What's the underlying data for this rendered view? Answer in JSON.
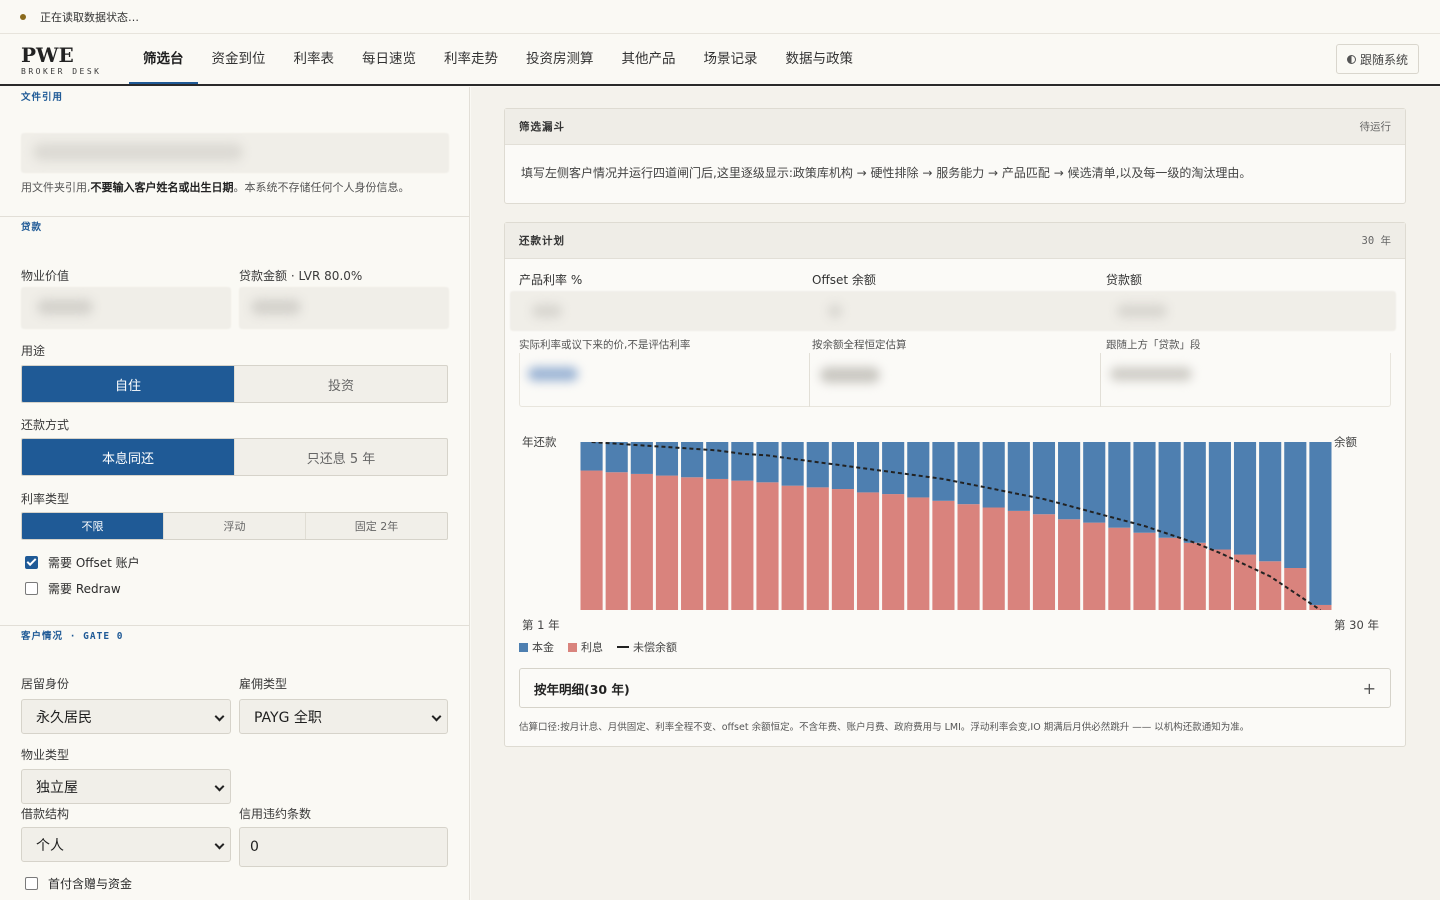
{
  "status": {
    "text": "正在读取数据状态…"
  },
  "brand": {
    "name": "PWE",
    "subtitle": "BROKER DESK"
  },
  "nav": {
    "tabs": [
      "筛选台",
      "资金到位",
      "利率表",
      "每日速览",
      "利率走势",
      "投资房测算",
      "其他产品",
      "场景记录",
      "数据与政策"
    ],
    "active": 0
  },
  "theme": {
    "label": "跟随系统"
  },
  "left": {
    "file_ref": {
      "section_label": "文件引用",
      "help_prefix": "用文件夹引用,",
      "help_bold": "不要输入客户姓名或出生日期",
      "help_suffix": "。本系统不存储任何个人身份信息。"
    },
    "loan": {
      "section_label": "贷款",
      "property_value_label": "物业价值",
      "loan_amount_label": "贷款金额 · LVR 80.0%",
      "purpose_label": "用途",
      "purpose_options": [
        "自住",
        "投资"
      ],
      "purpose_selected": 0,
      "repay_label": "还款方式",
      "repay_options": [
        "本息同还",
        "只还息 5 年"
      ],
      "repay_selected": 0,
      "rate_type_label": "利率类型",
      "rate_type_options": [
        "不限",
        "浮动",
        "固定 2年"
      ],
      "rate_type_selected": 0,
      "offset_label": "需要 Offset 账户",
      "offset_checked": true,
      "redraw_label": "需要 Redraw",
      "redraw_checked": false
    },
    "client": {
      "section_label": "客户情况 · GATE 0",
      "residency_label": "居留身份",
      "residency_value": "永久居民",
      "employment_label": "雇佣类型",
      "employment_value": "PAYG 全职",
      "property_type_label": "物业类型",
      "property_type_value": "独立屋",
      "borrower_label": "借款结构",
      "borrower_value": "个人",
      "credit_label": "信用违约条数",
      "credit_value": "0",
      "gift_label": "首付含赠与资金",
      "gift_checked": false
    }
  },
  "funnel": {
    "title": "筛选漏斗",
    "status": "待运行",
    "text": "填写左侧客户情况并运行四道闸门后,这里逐级显示:政策库机构 → 硬性排除 → 服务能力 → 产品匹配 → 候选清单,以及每一级的淘汰理由。"
  },
  "repayment": {
    "title": "还款计划",
    "term": "30 年",
    "columns": [
      {
        "label": "产品利率 %",
        "help": "实际利率或议下来的价,不是评估利率"
      },
      {
        "label": "Offset 余额",
        "help": "按余额全程恒定估算"
      },
      {
        "label": "贷款额",
        "help": "跟随上方「贷款」段"
      }
    ],
    "chart_left_label": "年还款",
    "chart_right_label": "余额",
    "x_start_label": "第 1 年",
    "x_end_label": "第 30 年",
    "legend": {
      "principal": "本金",
      "interest": "利息",
      "balance": "未偿余额"
    },
    "accordion_label": "按年明细(30 年)",
    "accordion_icon": "+",
    "footnote": "估算口径:按月计息、月供固定、利率全程不变、offset 余额恒定。不含年费、账户月费、政府费用与 LMI。浮动利率会变,IO 期满后月供必然跳升 —— 以机构还款通知为准。"
  },
  "colors": {
    "accent": "#1f5a96",
    "principal": "#4e7fb0",
    "interest": "#d9837d"
  },
  "chart_data": {
    "type": "bar",
    "stacked": true,
    "categories": [
      1,
      2,
      3,
      4,
      5,
      6,
      7,
      8,
      9,
      10,
      11,
      12,
      13,
      14,
      15,
      16,
      17,
      18,
      19,
      20,
      21,
      22,
      23,
      24,
      25,
      26,
      27,
      28,
      29,
      30
    ],
    "series": [
      {
        "name": "本金",
        "values": [
          0.17,
          0.18,
          0.19,
          0.2,
          0.21,
          0.22,
          0.23,
          0.24,
          0.26,
          0.27,
          0.28,
          0.3,
          0.31,
          0.33,
          0.35,
          0.37,
          0.39,
          0.41,
          0.43,
          0.46,
          0.48,
          0.51,
          0.54,
          0.57,
          0.6,
          0.64,
          0.67,
          0.71,
          0.75,
          0.97
        ]
      },
      {
        "name": "利息",
        "values": [
          0.83,
          0.82,
          0.81,
          0.8,
          0.79,
          0.78,
          0.77,
          0.76,
          0.74,
          0.73,
          0.72,
          0.7,
          0.69,
          0.67,
          0.65,
          0.63,
          0.61,
          0.59,
          0.57,
          0.54,
          0.52,
          0.49,
          0.46,
          0.43,
          0.4,
          0.36,
          0.33,
          0.29,
          0.25,
          0.03
        ]
      }
    ],
    "balance": [
      1.0,
      0.99,
      0.98,
      0.97,
      0.96,
      0.95,
      0.93,
      0.92,
      0.9,
      0.88,
      0.86,
      0.84,
      0.82,
      0.8,
      0.78,
      0.75,
      0.72,
      0.69,
      0.66,
      0.62,
      0.58,
      0.54,
      0.5,
      0.45,
      0.4,
      0.34,
      0.27,
      0.2,
      0.1,
      0.0
    ],
    "grid": false
  }
}
